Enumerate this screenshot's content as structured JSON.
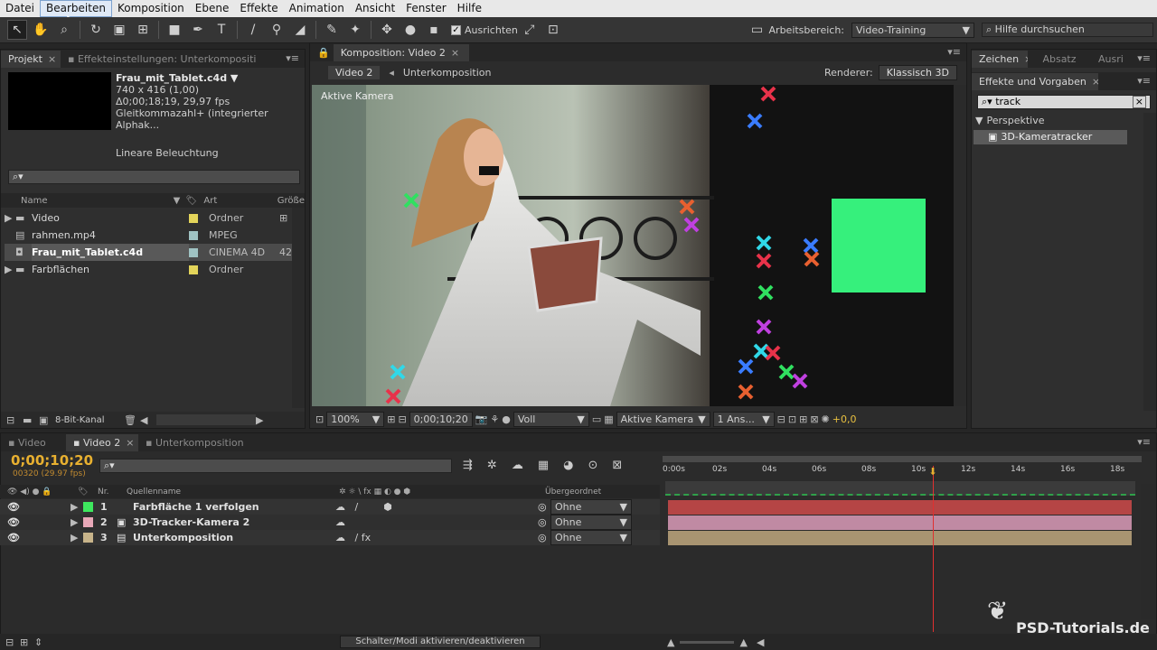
{
  "menu": [
    "Datei",
    "Bearbeiten",
    "Komposition",
    "Ebene",
    "Effekte",
    "Animation",
    "Ansicht",
    "Fenster",
    "Hilfe"
  ],
  "toolbar": {
    "align_label": "Ausrichten",
    "workspace_label": "Arbeitsbereich:",
    "workspace_value": "Video-Training",
    "help_placeholder": "Hilfe durchsuchen"
  },
  "project": {
    "tab": "Projekt",
    "tab2": "Effekteinstellungen: Unterkompositi",
    "file_name": "Frau_mit_Tablet.c4d ▼",
    "info1": "740 x 416 (1,00)",
    "info2": "Δ0;00;18;19, 29,97 fps",
    "info3": "Gleitkommazahl+ (integrierter Alphak...",
    "info4": "Lineare Beleuchtung",
    "col_name": "Name",
    "col_type": "Art",
    "col_size": "Größe",
    "items": [
      {
        "name": "Video",
        "type": "Ordner",
        "color": "#e3d45a",
        "size": ""
      },
      {
        "name": "rahmen.mp4",
        "type": "MPEG",
        "color": "#9fc2c2",
        "size": ""
      },
      {
        "name": "Frau_mit_Tablet.c4d",
        "type": "CINEMA 4D",
        "color": "#9fc2c2",
        "size": "42"
      },
      {
        "name": "Farbflächen",
        "type": "Ordner",
        "color": "#e3d45a",
        "size": ""
      }
    ],
    "bit_label": "8-Bit-Kanal"
  },
  "comp": {
    "tab": "Komposition: Video 2",
    "crumb1": "Video 2",
    "crumb2": "Unterkomposition",
    "renderer_label": "Renderer:",
    "renderer_value": "Klassisch 3D",
    "camera_label": "Aktive Kamera",
    "zoom": "100%",
    "timecode": "0;00;10;20",
    "resolution": "Voll",
    "view": "Aktive Kamera",
    "views": "1 Ans...",
    "exposure": "+0,0"
  },
  "effects": {
    "tab1": "Zeichen",
    "tab2": "Absatz",
    "tab3": "Ausri",
    "panel_title": "Effekte und Vorgaben",
    "search_value": "track",
    "category": "Perspektive",
    "item": "3D-Kameratracker"
  },
  "timeline": {
    "tab1": "Video",
    "tab2": "Video 2",
    "tab3": "Unterkomposition",
    "timecode": "0;00;10;20",
    "frames": "00320 (29.97 fps)",
    "col_nr": "Nr.",
    "col_source": "Quellenname",
    "col_parent": "Übergeordnet",
    "layers": [
      {
        "nr": "1",
        "name": "Farbfläche 1 verfolgen",
        "label_color": "#3ee85e",
        "parent": "Ohne",
        "bar_color": "#b54545"
      },
      {
        "nr": "2",
        "name": "3D-Tracker-Kamera 2",
        "label_color": "#e8a8b8",
        "parent": "Ohne",
        "bar_color": "#c08aa3"
      },
      {
        "nr": "3",
        "name": "Unterkomposition",
        "label_color": "#c8b48a",
        "parent": "Ohne",
        "bar_color": "#a89471"
      }
    ],
    "ticks": [
      "0:00s",
      "02s",
      "04s",
      "06s",
      "08s",
      "10s",
      "12s",
      "14s",
      "16s",
      "18s"
    ],
    "playhead_fraction": 0.57,
    "switch_label": "Schalter/Modi aktivieren/deaktivieren"
  },
  "watermark": "PSD-Tutorials.de"
}
